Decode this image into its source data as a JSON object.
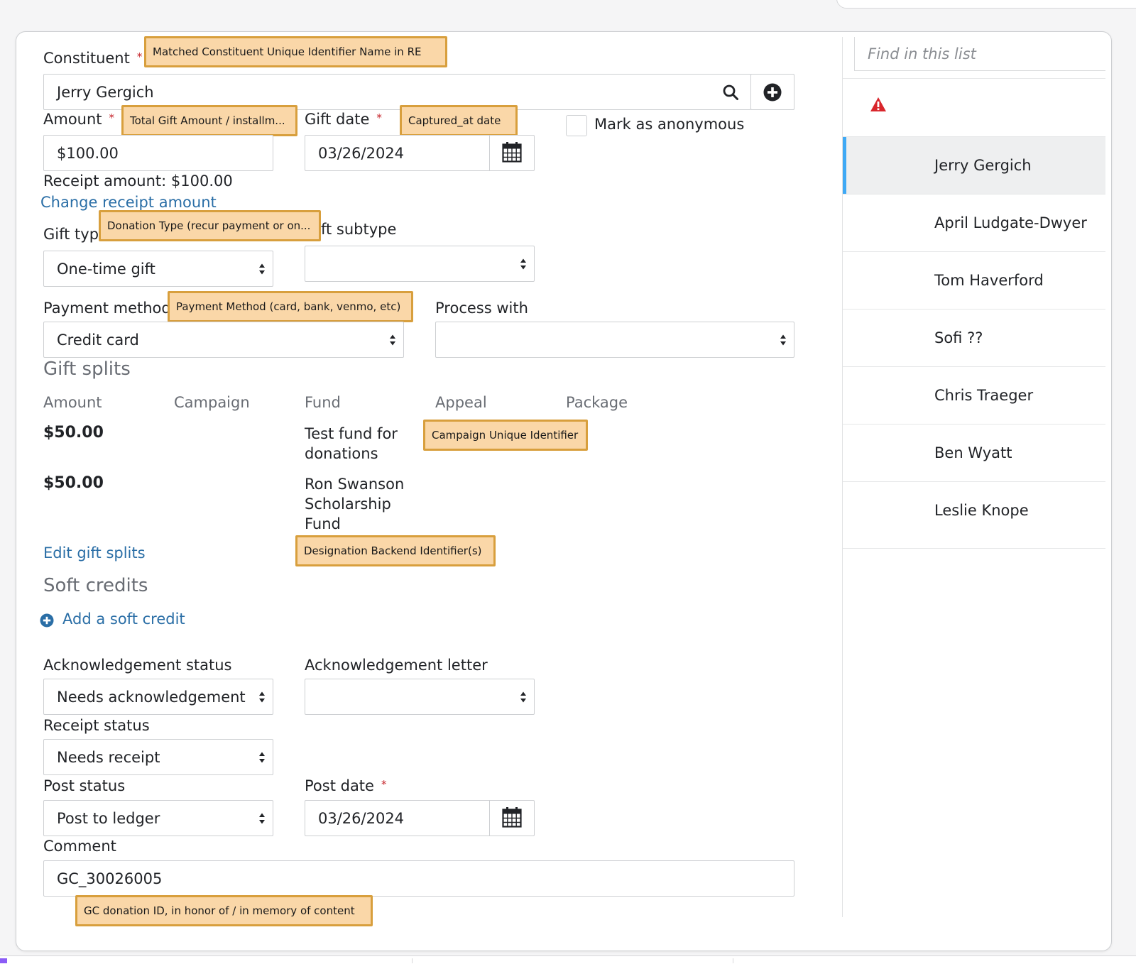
{
  "form": {
    "constituent_label": "Constituent",
    "constituent_value": "Jerry Gergich",
    "amount_label": "Amount",
    "amount_value": "$100.00",
    "gift_date_label": "Gift date",
    "gift_date_value": "03/26/2024",
    "anonymous_label": "Mark as anonymous",
    "receipt_amount_text": "Receipt amount: $100.00",
    "change_receipt_link": "Change receipt amount",
    "gift_type_label": "Gift typ",
    "gift_type_value": "One-time gift",
    "gift_subtype_label": "ft subtype",
    "gift_subtype_value": "",
    "payment_method_label": "Payment method",
    "payment_method_value": "Credit card",
    "process_with_label": "Process with",
    "process_with_value": ""
  },
  "splits": {
    "title": "Gift splits",
    "columns": [
      "Amount",
      "Campaign",
      "Fund",
      "Appeal",
      "Package"
    ],
    "rows": [
      {
        "amount": "$50.00",
        "fund": "Test fund for donations"
      },
      {
        "amount": "$50.00",
        "fund": "Ron Swanson Scholarship Fund"
      }
    ],
    "edit_link": "Edit gift splits"
  },
  "soft_credits": {
    "title": "Soft credits",
    "add_link": "Add a soft credit"
  },
  "ack": {
    "status_label": "Acknowledgement status",
    "status_value": "Needs acknowledgement",
    "letter_label": "Acknowledgement letter",
    "letter_value": "",
    "receipt_label": "Receipt status",
    "receipt_value": "Needs receipt",
    "post_status_label": "Post status",
    "post_status_value": "Post to ledger",
    "post_date_label": "Post date",
    "post_date_value": "03/26/2024",
    "comment_label": "Comment",
    "comment_value": "GC_30026005",
    "required_mark": "*"
  },
  "annotations": {
    "constituent": "Matched Constituent Unique Identifier Name in RE",
    "amount": "Total Gift Amount / installm...",
    "gift_date": "Captured_at date",
    "gift_type": "Donation Type (recur payment or on...",
    "payment_method": "Payment Method (card, bank, venmo, etc)",
    "appeal": "Campaign Unique Identifier",
    "fund": "Designation Backend Identifier(s)",
    "comment": "GC donation ID, in honor of / in memory of content"
  },
  "sidebar": {
    "search_placeholder": "Find in this list",
    "items": [
      "Jerry Gergich",
      "April Ludgate-Dwyer",
      "Tom Haverford",
      "Sofi ??",
      "Chris Traeger",
      "Ben Wyatt",
      "Leslie Knope"
    ],
    "active_index": 0
  },
  "colors": {
    "link": "#2a6ea6",
    "required": "#c6262c",
    "annotation_fill": "#fad7a8",
    "annotation_border": "#d89f3d",
    "active_item_bar": "#3fa9f5",
    "warning": "#d9262c"
  },
  "icons": {
    "search": "search-icon",
    "add": "plus-circle-icon",
    "calendar": "calendar-icon",
    "warning": "warning-triangle-icon",
    "select": "select-arrows-icon"
  }
}
